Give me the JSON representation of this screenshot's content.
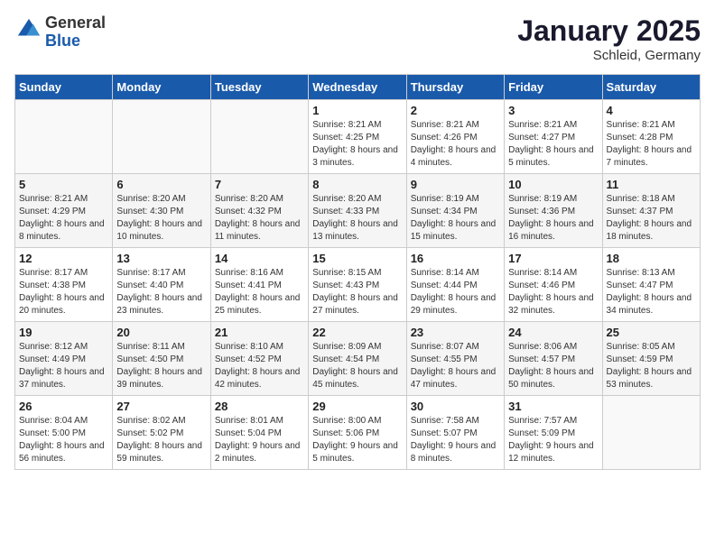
{
  "header": {
    "logo_general": "General",
    "logo_blue": "Blue",
    "month_title": "January 2025",
    "location": "Schleid, Germany"
  },
  "weekdays": [
    "Sunday",
    "Monday",
    "Tuesday",
    "Wednesday",
    "Thursday",
    "Friday",
    "Saturday"
  ],
  "weeks": [
    [
      {
        "day": "",
        "sunrise": "",
        "sunset": "",
        "daylight": ""
      },
      {
        "day": "",
        "sunrise": "",
        "sunset": "",
        "daylight": ""
      },
      {
        "day": "",
        "sunrise": "",
        "sunset": "",
        "daylight": ""
      },
      {
        "day": "1",
        "sunrise": "Sunrise: 8:21 AM",
        "sunset": "Sunset: 4:25 PM",
        "daylight": "Daylight: 8 hours and 3 minutes."
      },
      {
        "day": "2",
        "sunrise": "Sunrise: 8:21 AM",
        "sunset": "Sunset: 4:26 PM",
        "daylight": "Daylight: 8 hours and 4 minutes."
      },
      {
        "day": "3",
        "sunrise": "Sunrise: 8:21 AM",
        "sunset": "Sunset: 4:27 PM",
        "daylight": "Daylight: 8 hours and 5 minutes."
      },
      {
        "day": "4",
        "sunrise": "Sunrise: 8:21 AM",
        "sunset": "Sunset: 4:28 PM",
        "daylight": "Daylight: 8 hours and 7 minutes."
      }
    ],
    [
      {
        "day": "5",
        "sunrise": "Sunrise: 8:21 AM",
        "sunset": "Sunset: 4:29 PM",
        "daylight": "Daylight: 8 hours and 8 minutes."
      },
      {
        "day": "6",
        "sunrise": "Sunrise: 8:20 AM",
        "sunset": "Sunset: 4:30 PM",
        "daylight": "Daylight: 8 hours and 10 minutes."
      },
      {
        "day": "7",
        "sunrise": "Sunrise: 8:20 AM",
        "sunset": "Sunset: 4:32 PM",
        "daylight": "Daylight: 8 hours and 11 minutes."
      },
      {
        "day": "8",
        "sunrise": "Sunrise: 8:20 AM",
        "sunset": "Sunset: 4:33 PM",
        "daylight": "Daylight: 8 hours and 13 minutes."
      },
      {
        "day": "9",
        "sunrise": "Sunrise: 8:19 AM",
        "sunset": "Sunset: 4:34 PM",
        "daylight": "Daylight: 8 hours and 15 minutes."
      },
      {
        "day": "10",
        "sunrise": "Sunrise: 8:19 AM",
        "sunset": "Sunset: 4:36 PM",
        "daylight": "Daylight: 8 hours and 16 minutes."
      },
      {
        "day": "11",
        "sunrise": "Sunrise: 8:18 AM",
        "sunset": "Sunset: 4:37 PM",
        "daylight": "Daylight: 8 hours and 18 minutes."
      }
    ],
    [
      {
        "day": "12",
        "sunrise": "Sunrise: 8:17 AM",
        "sunset": "Sunset: 4:38 PM",
        "daylight": "Daylight: 8 hours and 20 minutes."
      },
      {
        "day": "13",
        "sunrise": "Sunrise: 8:17 AM",
        "sunset": "Sunset: 4:40 PM",
        "daylight": "Daylight: 8 hours and 23 minutes."
      },
      {
        "day": "14",
        "sunrise": "Sunrise: 8:16 AM",
        "sunset": "Sunset: 4:41 PM",
        "daylight": "Daylight: 8 hours and 25 minutes."
      },
      {
        "day": "15",
        "sunrise": "Sunrise: 8:15 AM",
        "sunset": "Sunset: 4:43 PM",
        "daylight": "Daylight: 8 hours and 27 minutes."
      },
      {
        "day": "16",
        "sunrise": "Sunrise: 8:14 AM",
        "sunset": "Sunset: 4:44 PM",
        "daylight": "Daylight: 8 hours and 29 minutes."
      },
      {
        "day": "17",
        "sunrise": "Sunrise: 8:14 AM",
        "sunset": "Sunset: 4:46 PM",
        "daylight": "Daylight: 8 hours and 32 minutes."
      },
      {
        "day": "18",
        "sunrise": "Sunrise: 8:13 AM",
        "sunset": "Sunset: 4:47 PM",
        "daylight": "Daylight: 8 hours and 34 minutes."
      }
    ],
    [
      {
        "day": "19",
        "sunrise": "Sunrise: 8:12 AM",
        "sunset": "Sunset: 4:49 PM",
        "daylight": "Daylight: 8 hours and 37 minutes."
      },
      {
        "day": "20",
        "sunrise": "Sunrise: 8:11 AM",
        "sunset": "Sunset: 4:50 PM",
        "daylight": "Daylight: 8 hours and 39 minutes."
      },
      {
        "day": "21",
        "sunrise": "Sunrise: 8:10 AM",
        "sunset": "Sunset: 4:52 PM",
        "daylight": "Daylight: 8 hours and 42 minutes."
      },
      {
        "day": "22",
        "sunrise": "Sunrise: 8:09 AM",
        "sunset": "Sunset: 4:54 PM",
        "daylight": "Daylight: 8 hours and 45 minutes."
      },
      {
        "day": "23",
        "sunrise": "Sunrise: 8:07 AM",
        "sunset": "Sunset: 4:55 PM",
        "daylight": "Daylight: 8 hours and 47 minutes."
      },
      {
        "day": "24",
        "sunrise": "Sunrise: 8:06 AM",
        "sunset": "Sunset: 4:57 PM",
        "daylight": "Daylight: 8 hours and 50 minutes."
      },
      {
        "day": "25",
        "sunrise": "Sunrise: 8:05 AM",
        "sunset": "Sunset: 4:59 PM",
        "daylight": "Daylight: 8 hours and 53 minutes."
      }
    ],
    [
      {
        "day": "26",
        "sunrise": "Sunrise: 8:04 AM",
        "sunset": "Sunset: 5:00 PM",
        "daylight": "Daylight: 8 hours and 56 minutes."
      },
      {
        "day": "27",
        "sunrise": "Sunrise: 8:02 AM",
        "sunset": "Sunset: 5:02 PM",
        "daylight": "Daylight: 8 hours and 59 minutes."
      },
      {
        "day": "28",
        "sunrise": "Sunrise: 8:01 AM",
        "sunset": "Sunset: 5:04 PM",
        "daylight": "Daylight: 9 hours and 2 minutes."
      },
      {
        "day": "29",
        "sunrise": "Sunrise: 8:00 AM",
        "sunset": "Sunset: 5:06 PM",
        "daylight": "Daylight: 9 hours and 5 minutes."
      },
      {
        "day": "30",
        "sunrise": "Sunrise: 7:58 AM",
        "sunset": "Sunset: 5:07 PM",
        "daylight": "Daylight: 9 hours and 8 minutes."
      },
      {
        "day": "31",
        "sunrise": "Sunrise: 7:57 AM",
        "sunset": "Sunset: 5:09 PM",
        "daylight": "Daylight: 9 hours and 12 minutes."
      },
      {
        "day": "",
        "sunrise": "",
        "sunset": "",
        "daylight": ""
      }
    ]
  ]
}
